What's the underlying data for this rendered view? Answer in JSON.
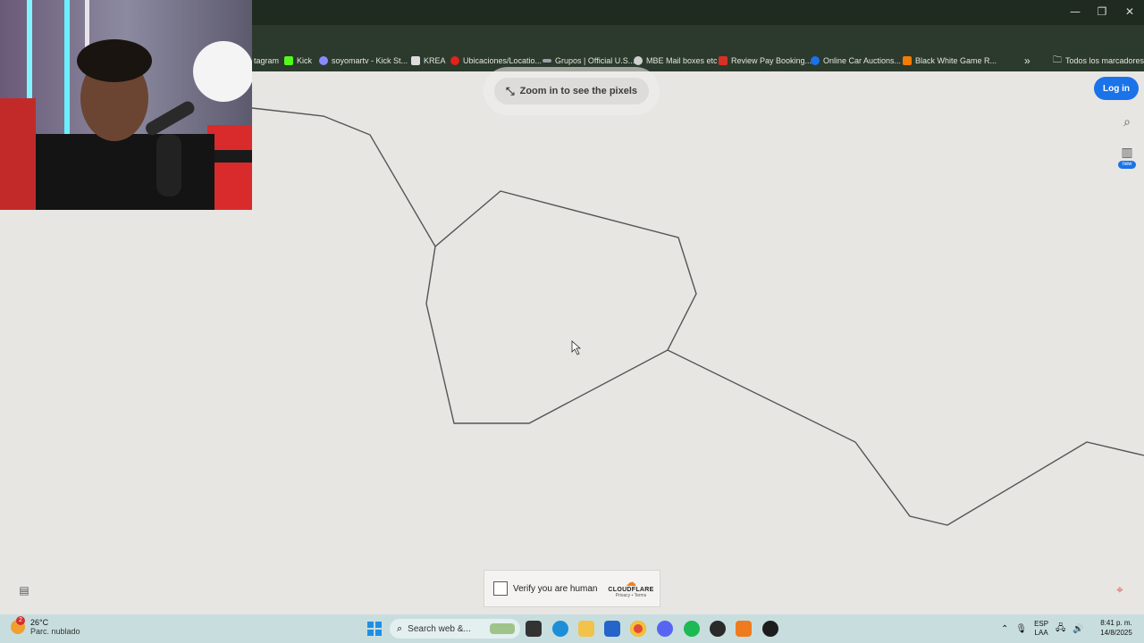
{
  "browser": {
    "bookmarks": [
      {
        "label": "tagram",
        "color": "#c13584"
      },
      {
        "label": "Kick",
        "color": "#53fc18"
      },
      {
        "label": "soyomartv - Kick St...",
        "color": "#8a8aff"
      },
      {
        "label": "KREA",
        "color": "#dddddd"
      },
      {
        "label": "Ubicaciones/Locatio...",
        "color": "#e2231a"
      },
      {
        "label": "Grupos | Official U.S...",
        "color": "#9aa0a6"
      },
      {
        "label": "MBE Mail boxes etc",
        "color": "#cfcfcf"
      },
      {
        "label": "Review Pay Booking...",
        "color": "#d93025"
      },
      {
        "label": "Online Car Auctions...",
        "color": "#1a73e8"
      },
      {
        "label": "Black White Game R...",
        "color": "#f57c00"
      }
    ],
    "overflow_label": "»",
    "all_bookmarks_label": "Todos los marcadores"
  },
  "page": {
    "zoom_hint": "Zoom in to see the pixels",
    "login_label": "Log in",
    "new_badge": "new",
    "captcha": {
      "label": "Verify you are human",
      "brand": "CLOUDFLARE",
      "links": "Privacy • Terms"
    }
  },
  "taskbar": {
    "weather_temp": "26°C",
    "weather_desc": "Parc. nublado",
    "weather_badge": "2",
    "search_placeholder": "Search web &...",
    "lang_top": "ESP",
    "lang_bottom": "LAA",
    "time": "8:41 p. m.",
    "date": "14/8/2025"
  },
  "icons": {
    "install": "install-app-icon",
    "bookmark_star": "star-icon",
    "menu": "kebab-menu-icon",
    "folder": "folder-icon"
  },
  "colors": {
    "accent": "#1a73e8",
    "page_bg": "#e8e6e3",
    "chrome_bg": "#2b3a2c",
    "taskbar_bg": "#c8dede",
    "line": "#555555"
  }
}
